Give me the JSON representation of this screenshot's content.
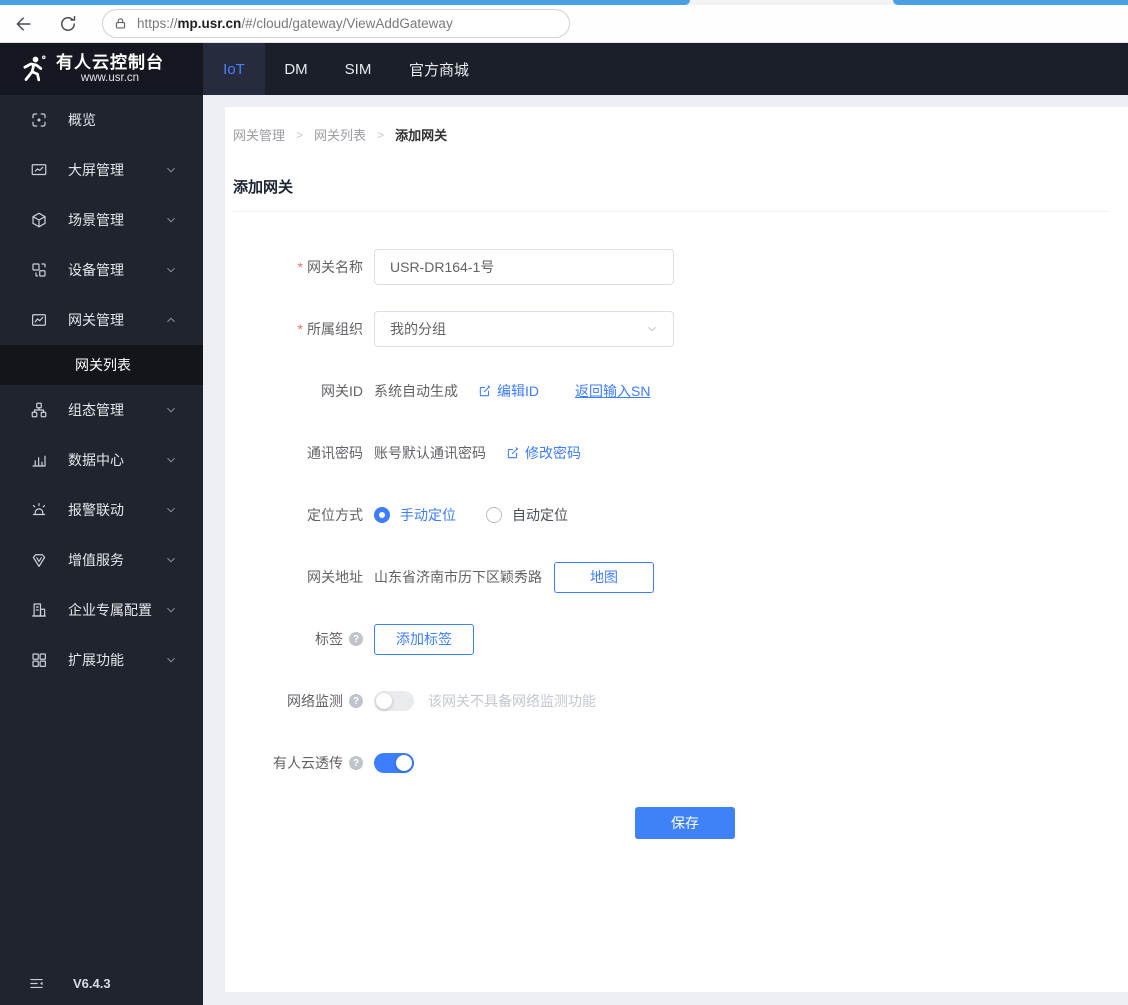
{
  "colors": {
    "accent": "#3d7dff",
    "save_button": "#3f82f7",
    "browser_strip": "#4aa0e4",
    "sidebar_bg": "#20242e",
    "nav_bg": "#1b1f29",
    "nav_active_bg": "#262c3d",
    "nav_active_fg": "#4a7eff",
    "submenu_active_bg": "#13151b",
    "page_bg": "#edeff4",
    "required_mark": "#f56c6c"
  },
  "browser": {
    "url_scheme": "https://",
    "url_host": "mp.usr.cn",
    "url_path": "/#/cloud/gateway/ViewAddGateway"
  },
  "brand": {
    "title": "有人云控制台",
    "subtitle": "www.usr.cn"
  },
  "topnav": {
    "tabs": [
      {
        "label": "IoT",
        "active": true
      },
      {
        "label": "DM",
        "active": false
      },
      {
        "label": "SIM",
        "active": false
      },
      {
        "label": "官方商城",
        "active": false
      }
    ]
  },
  "sidebar": {
    "items": [
      {
        "label": "概览",
        "icon": "overview-icon"
      },
      {
        "label": "大屏管理",
        "icon": "screen-icon",
        "chevron": "down"
      },
      {
        "label": "场景管理",
        "icon": "scene-icon",
        "chevron": "down"
      },
      {
        "label": "设备管理",
        "icon": "device-icon",
        "chevron": "down"
      },
      {
        "label": "网关管理",
        "icon": "gateway-icon",
        "chevron": "up",
        "submenu": [
          {
            "label": "网关列表",
            "active": true
          }
        ]
      },
      {
        "label": "组态管理",
        "icon": "scada-icon",
        "chevron": "down"
      },
      {
        "label": "数据中心",
        "icon": "data-center-icon",
        "chevron": "down"
      },
      {
        "label": "报警联动",
        "icon": "alarm-icon",
        "chevron": "down"
      },
      {
        "label": "增值服务",
        "icon": "value-added-icon",
        "chevron": "down"
      },
      {
        "label": "企业专属配置",
        "icon": "enterprise-icon",
        "chevron": "down"
      },
      {
        "label": "扩展功能",
        "icon": "extension-icon",
        "chevron": "down"
      }
    ],
    "version": "V6.4.3"
  },
  "breadcrumb": {
    "items": [
      "网关管理",
      "网关列表",
      "添加网关"
    ]
  },
  "page": {
    "title": "添加网关"
  },
  "form": {
    "gateway_name": {
      "label": "网关名称",
      "required": true,
      "value": "USR-DR164-1号"
    },
    "organization": {
      "label": "所属组织",
      "required": true,
      "value": "我的分组"
    },
    "gateway_id": {
      "label": "网关ID",
      "value": "系统自动生成",
      "edit_link": "编辑ID",
      "sn_link": "返回输入SN"
    },
    "comm_password": {
      "label": "通讯密码",
      "value": "账号默认通讯密码",
      "edit_link": "修改密码"
    },
    "location_mode": {
      "label": "定位方式",
      "options": [
        {
          "label": "手动定位",
          "selected": true
        },
        {
          "label": "自动定位",
          "selected": false
        }
      ]
    },
    "gateway_address": {
      "label": "网关地址",
      "value": "山东省济南市历下区颖秀路",
      "map_button": "地图"
    },
    "tags": {
      "label": "标签",
      "add_button": "添加标签"
    },
    "network_monitor": {
      "label": "网络监测",
      "enabled": false,
      "hint": "该网关不具备网络监测功能"
    },
    "cloud_passthrough": {
      "label": "有人云透传",
      "enabled": true
    },
    "save_button": "保存"
  }
}
